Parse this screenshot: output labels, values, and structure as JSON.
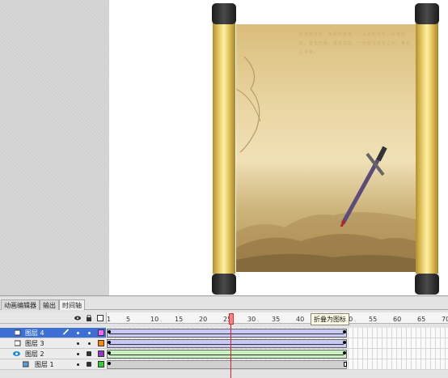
{
  "tabs": [
    {
      "label": "动画编辑器",
      "active": false
    },
    {
      "label": "输出",
      "active": false
    },
    {
      "label": "时间轴",
      "active": true
    }
  ],
  "ruler": {
    "ticks": [
      "1",
      "5",
      "10",
      "15",
      "20",
      "25",
      "30",
      "35",
      "40",
      "45",
      "50",
      "55",
      "60",
      "65",
      "70"
    ],
    "current_frame": 25
  },
  "layers": [
    {
      "name": "图层 4",
      "selected": true,
      "locked": false,
      "color": "#ff66ff",
      "tween_color": "#c9c9f5",
      "has_pencil": true
    },
    {
      "name": "图层 3",
      "selected": false,
      "locked": false,
      "color": "#ff8800",
      "tween_color": "#c9c9f5",
      "has_pencil": false
    },
    {
      "name": "图层 2",
      "selected": false,
      "locked": true,
      "color": "#9933cc",
      "tween_color": "#c8f0c0",
      "has_pencil": false
    },
    {
      "name": "图层 1",
      "selected": false,
      "locked": true,
      "color": "#33cc33",
      "tween_color": "#d0d0d0",
      "has_pencil": false
    }
  ],
  "tooltip": "折叠为图标",
  "scroll_poem": "东方的天空，无尽的苍穹，一点点的光芒。大地如此，苍生万物，是是非非。一切都在变化之中，唯有心不变。"
}
